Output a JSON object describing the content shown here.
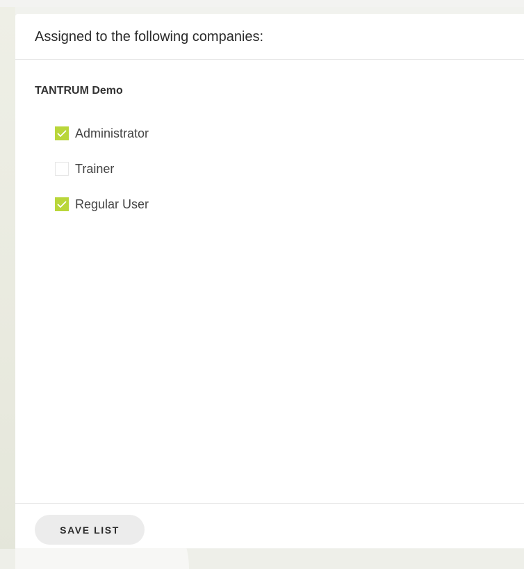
{
  "panel": {
    "title": "Assigned to the following companies:"
  },
  "company": {
    "name": "TANTRUM Demo",
    "roles": [
      {
        "label": "Administrator",
        "checked": true
      },
      {
        "label": "Trainer",
        "checked": false
      },
      {
        "label": "Regular User",
        "checked": true
      }
    ]
  },
  "footer": {
    "save_label": "SAVE LIST"
  },
  "colors": {
    "checkbox_checked": "#b9d63a",
    "checkmark": "#ffffff",
    "button_bg": "#ececec"
  },
  "icons": {
    "check": "checkmark-icon"
  }
}
